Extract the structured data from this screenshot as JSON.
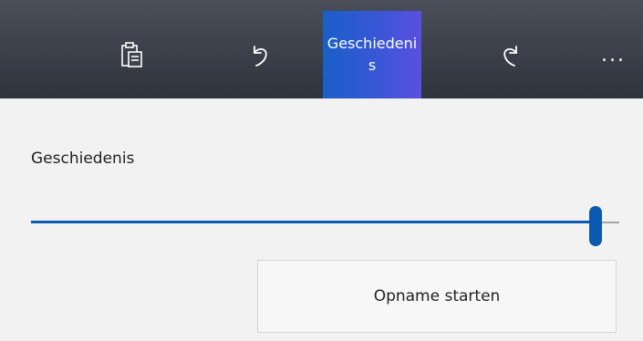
{
  "toolbar": {
    "paste_icon": "clipboard-paste-icon",
    "undo_icon": "undo-icon",
    "history_label": "Geschiedenis",
    "redo_icon": "redo-icon",
    "more_label": "..."
  },
  "history_panel": {
    "title": "Geschiedenis",
    "slider_value_fraction": 0.96,
    "record_button_label": "Opname starten"
  },
  "colors": {
    "accent": "#0a5ab0",
    "selected_tab_start": "#1a5fc7",
    "selected_tab_end": "#5a4fe0",
    "toolbar_bg": "#3d424c"
  }
}
